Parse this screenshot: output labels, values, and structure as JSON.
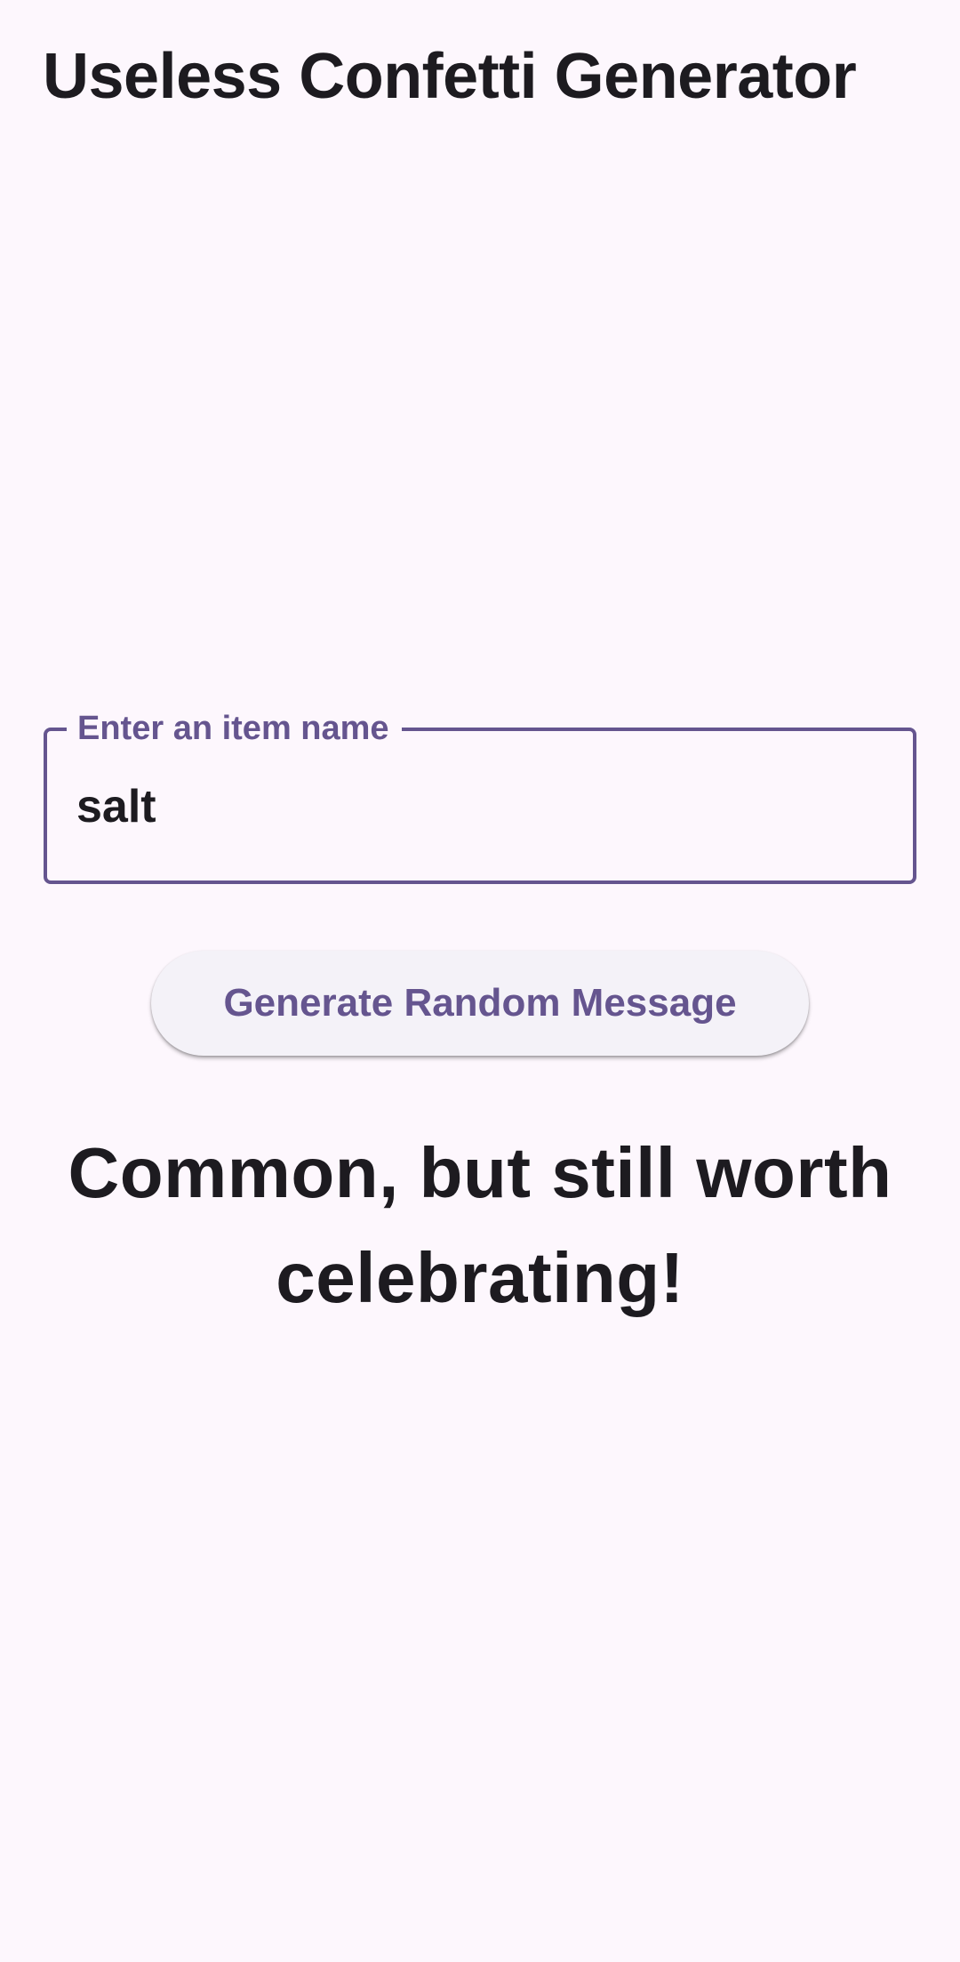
{
  "app": {
    "title": "Useless Confetti Generator"
  },
  "form": {
    "input_label": "Enter an item name",
    "input_value": "salt",
    "generate_button_label": "Generate Random Message"
  },
  "result": {
    "message": "Common, but still worth celebrating!"
  },
  "colors": {
    "background": "#fdf7fd",
    "accent": "#65558f",
    "text": "#1d1b20",
    "button_surface": "#f4f2f8"
  }
}
